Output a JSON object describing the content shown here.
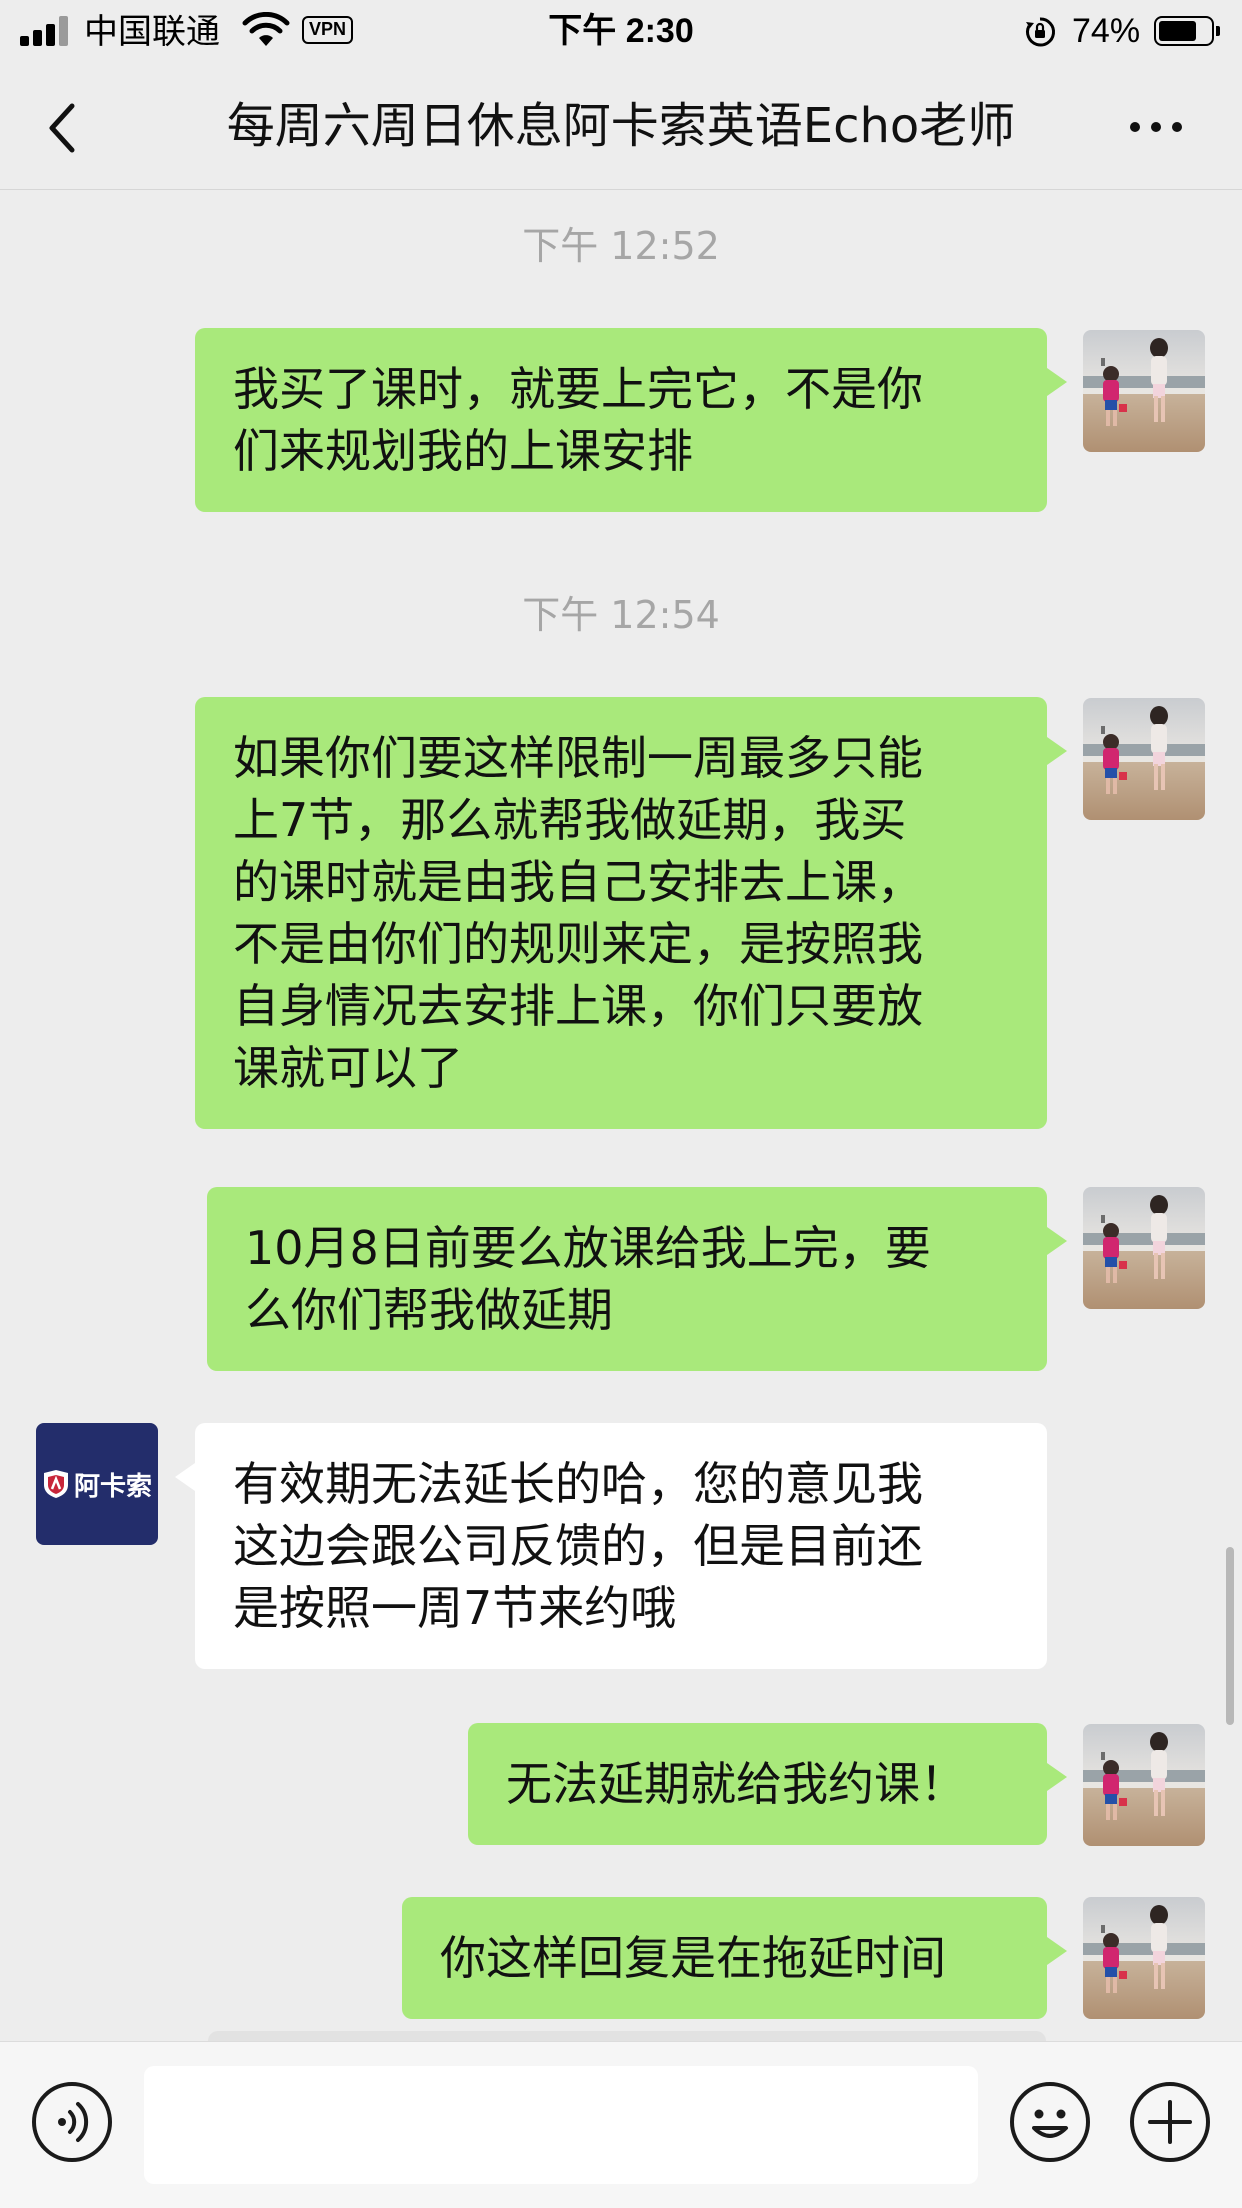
{
  "status_bar": {
    "carrier": "中国联通",
    "vpn": "VPN",
    "time": "下午 2:30",
    "battery_percent": "74%",
    "battery_level": 0.74,
    "signal_icon": "signal-bars-icon",
    "wifi_icon": "wifi-icon",
    "orientation_lock_icon": "orientation-lock-icon"
  },
  "nav": {
    "title": "每周六周日休息阿卡索英语Echo老师",
    "back_icon": "chevron-left-icon",
    "more_icon": "more-dots-icon"
  },
  "chat": {
    "timestamps": [
      "下午 12:52",
      "下午 12:54"
    ],
    "messages": [
      {
        "from": "me",
        "lines": [
          "我买了课时，就要上完它，不是你",
          "们来规划我的上课安排"
        ]
      },
      {
        "from": "me",
        "lines": [
          "如果你们要这样限制一周最多只能",
          "上7节，那么就帮我做延期，我买",
          "的课时就是由我自己安排去上课，",
          "不是由你们的规则来定，是按照我",
          "自身情况去安排上课，你们只要放",
          "课就可以了"
        ]
      },
      {
        "from": "me",
        "lines": [
          "10月8日前要么放课给我上完，要",
          "么你们帮我做延期"
        ]
      },
      {
        "from": "other",
        "lines": [
          "有效期无法延长的哈，您的意见我",
          "这边会跟公司反馈的，但是目前还",
          "是按照一周7节来约哦"
        ]
      },
      {
        "from": "me",
        "lines": [
          "无法延期就给我约课！"
        ]
      },
      {
        "from": "me",
        "lines": [
          "你这样回复是在拖延时间"
        ]
      }
    ],
    "other_avatar_text": "阿卡索"
  },
  "input_bar": {
    "voice_icon": "voice-icon",
    "emoji_icon": "emoji-icon",
    "plus_icon": "plus-icon",
    "value": ""
  },
  "colors": {
    "outgoing_bubble": "#a9e97b",
    "incoming_bubble": "#ffffff",
    "background": "#ededed",
    "akaso_brand": "#232d6b"
  }
}
